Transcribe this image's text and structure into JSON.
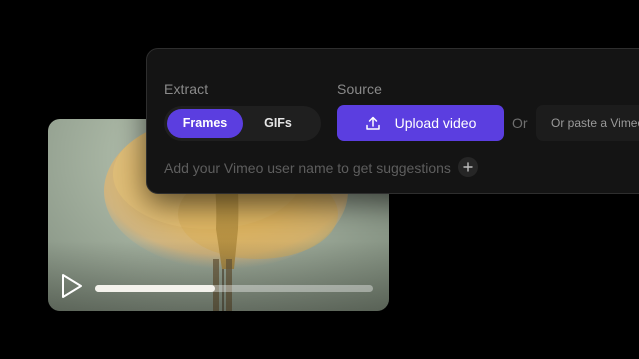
{
  "extract": {
    "label": "Extract",
    "options": [
      "Frames",
      "GIFs"
    ],
    "selected": "Frames"
  },
  "source": {
    "label": "Source",
    "upload_label": "Upload video",
    "or_label": "Or",
    "url_placeholder": "Or paste a Vimeo"
  },
  "suggestion": {
    "text": "Add your Vimeo user name to get suggestions"
  },
  "player": {
    "progress": 0.43
  },
  "colors": {
    "accent": "#5b3ee0",
    "panel_bg": "#141414",
    "page_bg": "#000000"
  },
  "icons": {
    "upload": "upload-icon",
    "play": "play-icon",
    "add": "plus-icon"
  }
}
